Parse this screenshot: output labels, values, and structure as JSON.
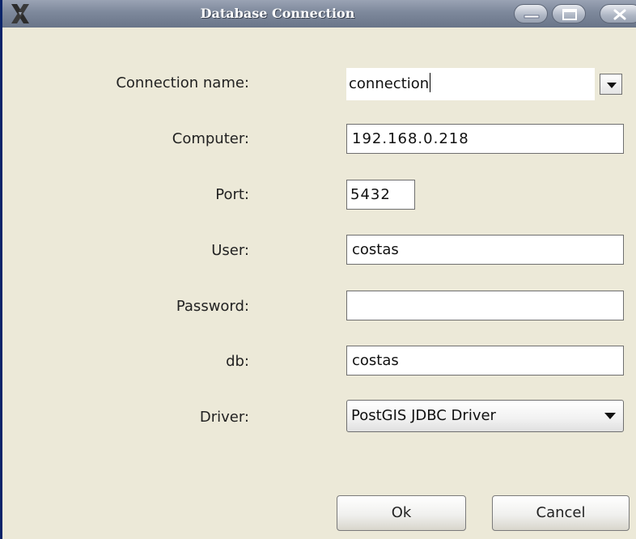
{
  "window": {
    "title": "Database Connection"
  },
  "form": {
    "connection_name_label": "Connection name:",
    "connection_name_value": "connection",
    "computer_label": "Computer:",
    "computer_value": "192.168.0.218",
    "port_label": "Port:",
    "port_value": "5432",
    "user_label": "User:",
    "user_value": "costas",
    "password_label": "Password:",
    "password_value": "",
    "db_label": "db:",
    "db_value": "costas",
    "driver_label": "Driver:",
    "driver_value": "PostGIS JDBC Driver"
  },
  "buttons": {
    "ok_label": "Ok",
    "cancel_label": "Cancel"
  },
  "icons": {
    "app": "x-logo-icon",
    "minimize": "minimize-icon",
    "maximize": "maximize-icon",
    "close": "close-icon",
    "dropdown": "chevron-down-icon"
  },
  "colors": {
    "dialog_background": "#ece9d8",
    "titlebar": "#7d889b",
    "field_background": "#ffffff",
    "window_border": "#0a246a"
  }
}
